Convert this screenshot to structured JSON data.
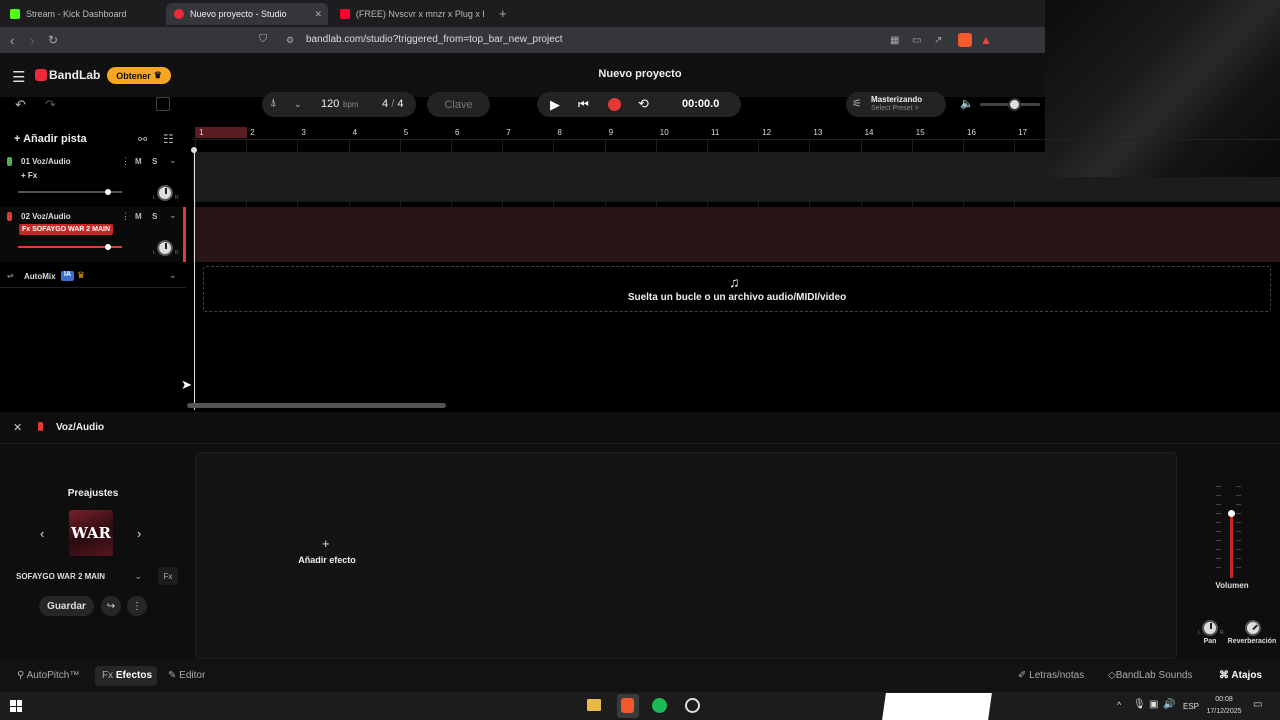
{
  "browser": {
    "tabs": [
      {
        "title": "Stream - Kick Dashboard",
        "color": "#53fc18"
      },
      {
        "title": "Nuevo proyecto - Studio",
        "color": "#f0283c"
      },
      {
        "title": "(FREE) Nvscvr x mnzr x Plug x Regga",
        "color": "#ff0033"
      }
    ],
    "url": "bandlab.com/studio?triggered_from=top_bar_new_project"
  },
  "app": {
    "logo": "BandLab",
    "obtener": "Obtener",
    "project_title": "Nuevo proyecto",
    "tempo": "120",
    "bpm_unit": "bpm",
    "time_sig_num": "4",
    "time_sig_sep": "/",
    "time_sig_den": "4",
    "key_label": "Clave",
    "time": "00:00.0",
    "mastering_title": "Masterizando",
    "mastering_preset": "Select Preset >",
    "add_track": "Añadir pista",
    "volume_level": 0.5
  },
  "ruler": [
    "1",
    "2",
    "3",
    "4",
    "5",
    "6",
    "7",
    "8",
    "9",
    "10",
    "11",
    "12",
    "13",
    "14",
    "15",
    "16",
    "17"
  ],
  "tracks": [
    {
      "name": "01  Voz/Audio",
      "fx": "+ Fx",
      "m": "M",
      "s": "S",
      "color": "#4caf50",
      "fader": 0.56
    },
    {
      "name": "02  Voz/Audio",
      "fx": "Fx  SOFAYGO WAR 2 MAIN",
      "m": "M",
      "s": "S",
      "color": "#e53935",
      "fader": 0.56
    }
  ],
  "automix": {
    "label": "AutoMix",
    "badge": "IA"
  },
  "drop_text": "Suelta un bucle o un archivo audio/MIDI/video",
  "panel": {
    "title": "Voz/Audio",
    "presets_title": "Preajustes",
    "preset_name": "SOFAYGO WAR 2 MAIN",
    "preset_art": "WAR",
    "save": "Guardar",
    "add_effect": "Añadir efecto",
    "volume": "Volumen",
    "pan": "Pan",
    "reverb": "Reverberación",
    "knob_l": "L",
    "knob_r": "R"
  },
  "bottom": {
    "autopitch": "AutoPitch™",
    "fx_prefix": "Fx",
    "effects": "Efectos",
    "editor": "Editor",
    "lyrics": "Letras/notas",
    "sounds": "BandLab Sounds",
    "shortcuts": "Atajos"
  },
  "taskbar": {
    "lang": "ESP",
    "time": "00:08",
    "date": "17/12/2025"
  }
}
